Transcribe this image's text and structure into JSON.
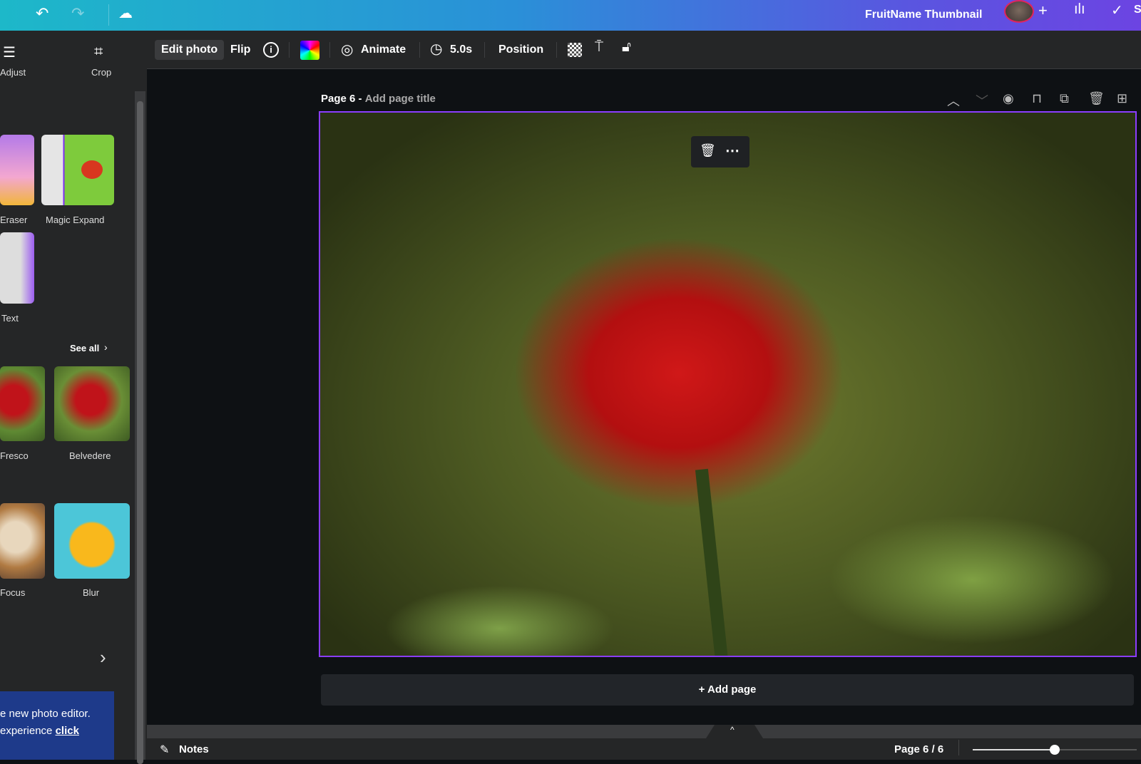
{
  "topbar": {
    "title": "FruitName Thumbnail",
    "icons": [
      "undo-icon",
      "redo-icon",
      "cloud-saved-icon",
      "plus-icon",
      "insights-icon",
      "check-circle-icon"
    ],
    "share_partial": "S"
  },
  "left_panel": {
    "adjust_label": "Adjust",
    "crop_label": "Crop",
    "tools": [
      {
        "label": "Eraser"
      },
      {
        "label": "Magic Expand"
      },
      {
        "label": "Text"
      }
    ],
    "see_all": "See all",
    "filters": [
      {
        "label": "Fresco"
      },
      {
        "label": "Belvedere"
      },
      {
        "label": "Focus"
      },
      {
        "label": "Blur"
      }
    ],
    "banner_line1": "e new photo editor.",
    "banner_line2": "experience ",
    "banner_link": "click"
  },
  "toolbar": {
    "edit_photo": "Edit photo",
    "flip": "Flip",
    "animate": "Animate",
    "duration": "5.0s",
    "position": "Position"
  },
  "page": {
    "label": "Page 6 -",
    "title_placeholder": "Add page title"
  },
  "add_page": "+ Add page",
  "footer": {
    "notes": "Notes",
    "page_indicator": "Page 6 / 6",
    "zoom_fraction": 0.5
  },
  "colors": {
    "accent": "#8b3dff",
    "topbar_start": "#1db8c9",
    "topbar_end": "#6c44e2"
  }
}
